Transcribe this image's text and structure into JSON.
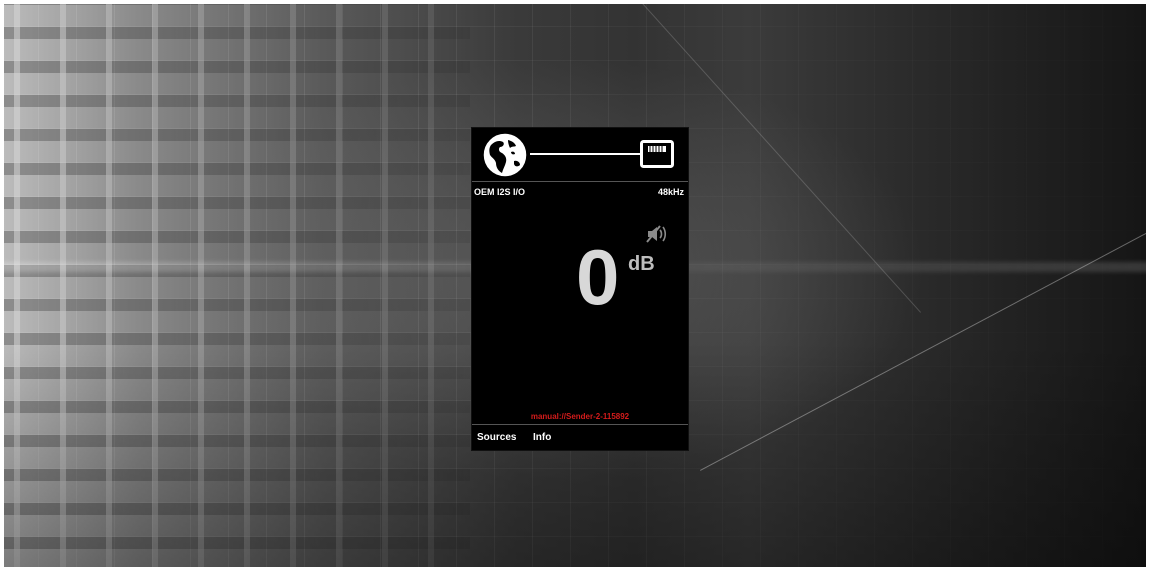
{
  "device": {
    "source_name": "OEM I2S I/O",
    "sample_rate": "48kHz",
    "volume_value": "0",
    "volume_unit": "dB",
    "stream_url": "manual://Sender-2-115892",
    "connection_icons": [
      "globe-icon",
      "ethernet-icon"
    ],
    "status_icon": "mute-icon",
    "accent_color": "#d41b1b"
  },
  "nav": {
    "tabs": [
      {
        "label": "Sources"
      },
      {
        "label": "Info"
      }
    ]
  }
}
